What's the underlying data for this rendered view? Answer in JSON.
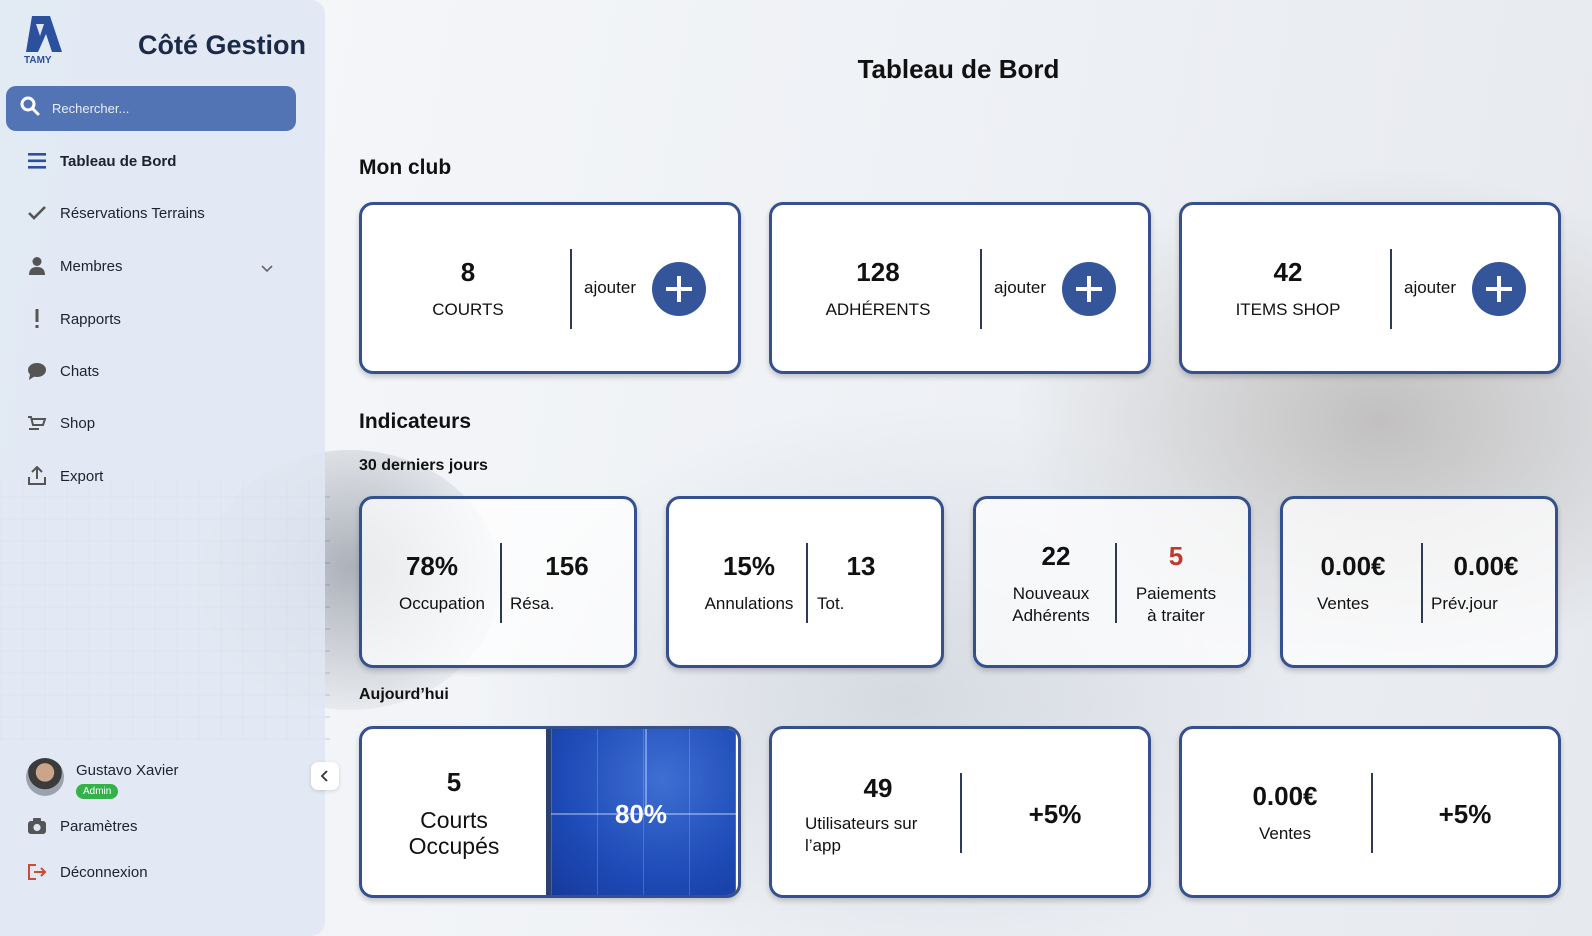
{
  "sidebar": {
    "logo_text": "TAMY",
    "brand_title": "Côté Gestion",
    "search_placeholder": "Rechercher...",
    "nav": [
      {
        "label": "Tableau de Bord",
        "icon": "menu-icon",
        "active": true
      },
      {
        "label": "Réservations Terrains",
        "icon": "check-icon"
      },
      {
        "label": "Membres",
        "icon": "user-icon"
      },
      {
        "label": "Rapports",
        "icon": "exclamation-icon"
      },
      {
        "label": "Chats",
        "icon": "chat-bubble-icon"
      },
      {
        "label": "Shop",
        "icon": "cart-icon"
      },
      {
        "label": "Export",
        "icon": "upload-icon"
      }
    ],
    "user": {
      "name": "Gustavo Xavier",
      "role": "Admin"
    },
    "settings_label": "Paramètres",
    "logout_label": "Déconnexion"
  },
  "main": {
    "title": "Tableau de Bord",
    "mon_club": {
      "title": "Mon club",
      "add_label": "ajouter",
      "cards": [
        {
          "value": "8",
          "label": "COURTS"
        },
        {
          "value": "128",
          "label": "ADHÉRENTS"
        },
        {
          "value": "42",
          "label": "ITEMS SHOP"
        }
      ]
    },
    "indicateurs": {
      "title": "Indicateurs",
      "period_label": "30 derniers jours",
      "cards": [
        {
          "left_value": "78%",
          "left_label": "Occupation",
          "right_value": "156",
          "right_label": "Résa."
        },
        {
          "left_value": "15%",
          "left_label": "Annulations",
          "right_value": "13",
          "right_label": "Tot."
        },
        {
          "left_value": "22",
          "left_label_1": "Nouveaux",
          "left_label_2": "Adhérents",
          "right_value": "5",
          "right_label_1": "Paiements",
          "right_label_2": "à traiter"
        },
        {
          "left_value": "0.00€",
          "left_label": "Ventes",
          "right_value": "0.00€",
          "right_label": "Prév.jour"
        }
      ]
    },
    "today": {
      "label": "Aujourd’hui",
      "courts": {
        "value": "5",
        "label_1": "Courts",
        "label_2": "Occupés",
        "percent": "80%"
      },
      "users": {
        "value": "49",
        "label_1": "Utilisateurs sur",
        "label_2": "l’app",
        "delta": "+5%"
      },
      "sales": {
        "value": "0.00€",
        "label": "Ventes",
        "delta": "+5%"
      }
    }
  },
  "colors": {
    "accent": "#34559a",
    "border": "#34508f",
    "search_bg": "#5374b4",
    "alert": "#c0392b",
    "badge": "#34b24a"
  }
}
